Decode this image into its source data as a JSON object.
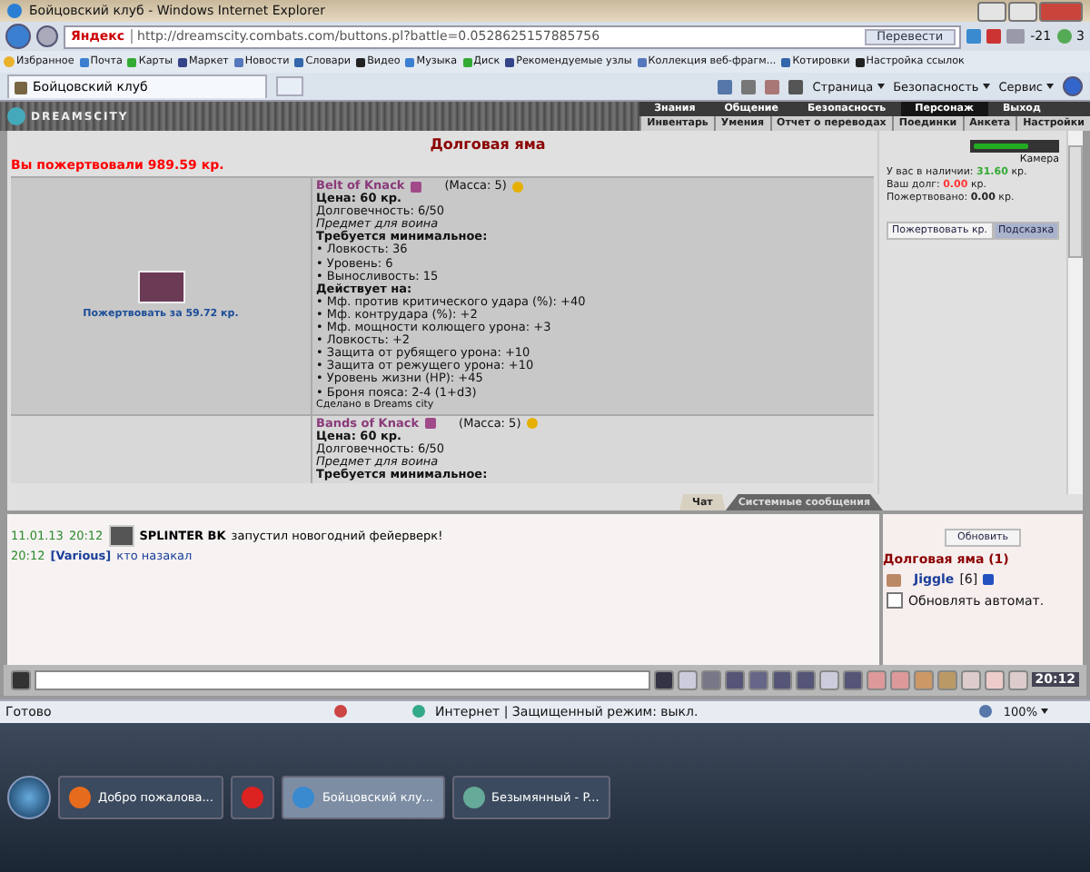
{
  "window": {
    "title": "Бойцовский клуб - Windows Internet Explorer"
  },
  "address_bar": {
    "search_logo": "Яндекс",
    "url": "http://dreamscity.combats.com/buttons.pl?battle=0.0528625157885756",
    "translate_button": "Перевести",
    "weather": "-21",
    "mail_count": "3"
  },
  "favorites": {
    "label": "Избранное",
    "items": [
      "Почта",
      "Карты",
      "Маркет",
      "Новости",
      "Словари",
      "Видео",
      "Музыка",
      "Диск",
      "Рекомендуемые узлы",
      "Коллекция веб-фрагм...",
      "Котировки",
      "Настройка ссылок"
    ]
  },
  "tab": {
    "label": "Бойцовский клуб"
  },
  "commands": [
    "Страница",
    "Безопасность",
    "Сервис"
  ],
  "game": {
    "logo": "DREAMSCITY",
    "nav_top": [
      {
        "label": "Знания",
        "selected": false
      },
      {
        "label": "Общение",
        "selected": false
      },
      {
        "label": "Безопасность",
        "selected": false
      },
      {
        "label": "Персонаж",
        "selected": true
      },
      {
        "label": "Выход",
        "selected": false
      }
    ],
    "nav_sub": [
      "Инвентарь",
      "Умения",
      "Отчет о переводах",
      "Поединки",
      "Анкета",
      "Настройки"
    ],
    "title": "Долговая яма",
    "donated": "Вы пожертвовали 989.59 кр.",
    "items": [
      {
        "name": "Belt of Knack",
        "mass": "(Масса: 5)",
        "price": "Цена: 60 кр.",
        "durability": "Долговечность: 6/50",
        "note": "Предмет для воина",
        "req_title": "Требуется минимальное:",
        "requirements": [
          "• Ловкость: 36",
          "• Уровень: 6",
          "• Выносливость: 15"
        ],
        "effects_title": "Действует на:",
        "effects": [
          "• Мф. против критического удара (%): +40",
          "• Мф. контрудара (%): +2",
          "• Мф. мощности колющего урона: +3",
          "• Ловкость: +2",
          "• Защита от рубящего урона: +10",
          "• Защита от режущего урона: +10",
          "• Уровень жизни (HP): +45",
          "• Броня пояса: 2-4 (1+d3)"
        ],
        "made": "Сделано в Dreams city",
        "donate_link": "Пожертвовать за 59.72 кр."
      },
      {
        "name": "Bands of Knack",
        "mass": "(Масса: 5)",
        "price": "Цена: 60 кр.",
        "durability": "Долговечность: 6/50",
        "note": "Предмет для воина",
        "req_title": "Требуется минимальное:"
      }
    ],
    "camera": "Камера",
    "balance": [
      {
        "label": "У вас в наличии:",
        "value": "31.60",
        "unit": "кр.",
        "color": "#33aa33"
      },
      {
        "label": "Ваш долг:",
        "value": "0.00",
        "unit": "кр.",
        "color": "#ff3333"
      },
      {
        "label": "Пожертвовано:",
        "value": "0.00",
        "unit": "кр.",
        "color": "#222222"
      }
    ],
    "panel_tabs": [
      {
        "label": "Пожертвовать кр.",
        "selected": false
      },
      {
        "label": "Подсказка",
        "selected": true
      }
    ]
  },
  "chat": {
    "tabs": [
      {
        "label": "Чат",
        "selected": true
      },
      {
        "label": "Системные сообщения",
        "selected": false
      }
    ],
    "messages": [
      {
        "kind": "system",
        "date": "11.01.13",
        "time": "20:12",
        "sender": "SPLINTER BK",
        "text": "запустил новогодний фейерверк!"
      },
      {
        "kind": "user",
        "time": "20:12",
        "sender": "[Various]",
        "text": "кто назакал"
      }
    ]
  },
  "room": {
    "refresh_button": "Обновить",
    "location": "Долговая яма (1)",
    "users": [
      {
        "name": "Jiggle",
        "level": "[6]"
      }
    ],
    "auto_refresh": {
      "label": "Обновлять автомат.",
      "checked": false
    }
  },
  "game_clock": "20:12",
  "status_bar": {
    "text": "Готово",
    "zone": "Интернет | Защищенный режим: выкл.",
    "zoom": "100%"
  },
  "taskbar": [
    {
      "label": "Добро пожалова...",
      "selected": false
    },
    {
      "selected": false
    },
    {
      "label": "Бойцовский клу...",
      "selected": true
    },
    {
      "label": "Безымянный - P...",
      "selected": false
    }
  ]
}
